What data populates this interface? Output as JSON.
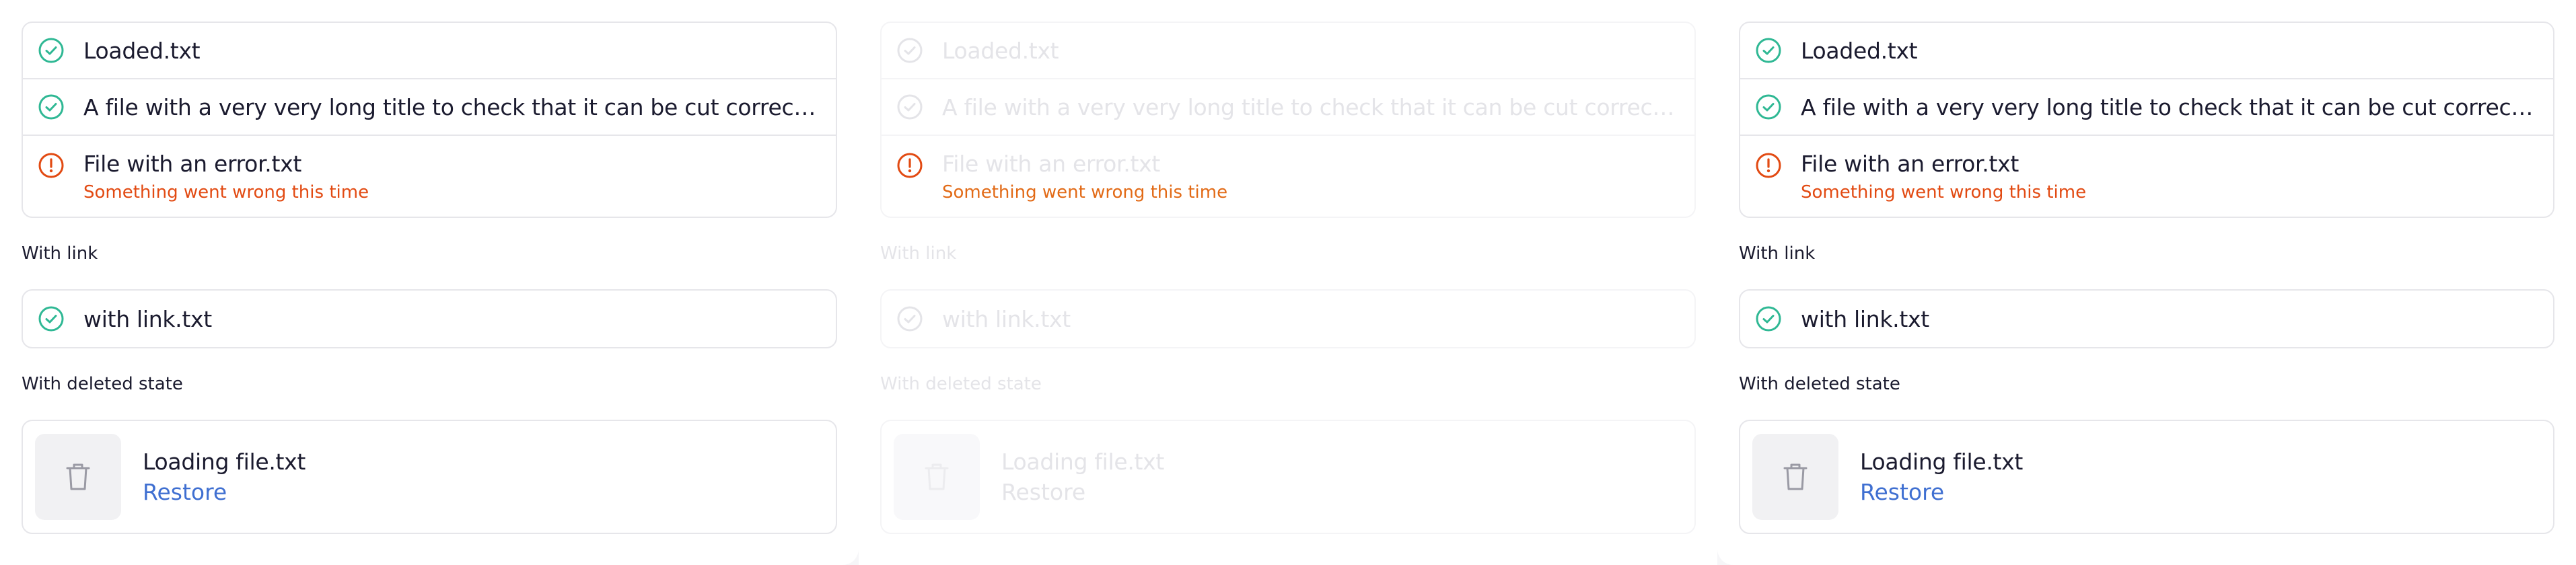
{
  "files": [
    {
      "name": "Loaded.txt",
      "status": "success"
    },
    {
      "name": "A file with a very very long title to check that it can be cut correctly.txt",
      "status": "success"
    },
    {
      "name": "File with an error.txt",
      "status": "error",
      "error": "Something went wrong this time"
    }
  ],
  "with_link": {
    "label": "With link",
    "file": "with link.txt"
  },
  "with_deleted": {
    "label": "With deleted state",
    "file": "Loading file.txt",
    "restore": "Restore"
  },
  "colors": {
    "success": "#2fb894",
    "error": "#e24a12",
    "link": "#3f6fd1",
    "border": "#e6e6ea"
  },
  "icons": {
    "success": "check-circle-icon",
    "error": "exclamation-circle-icon",
    "deleted": "trash-icon"
  }
}
